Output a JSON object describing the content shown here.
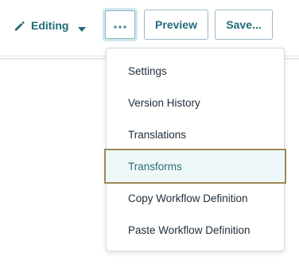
{
  "toolbar": {
    "mode_label": "Editing",
    "mode_icon": "pencil-icon",
    "mode_dropdown_icon": "caret-down-icon",
    "more_icon": "ellipsis-icon",
    "preview_label": "Preview",
    "save_label": "Save..."
  },
  "menu": {
    "items": [
      {
        "label": "Settings"
      },
      {
        "label": "Version History"
      },
      {
        "label": "Translations"
      },
      {
        "label": "Transforms",
        "highlighted": true
      },
      {
        "label": "Copy Workflow Definition"
      },
      {
        "label": "Paste Workflow Definition"
      }
    ]
  },
  "colors": {
    "accent": "#236b7a",
    "highlight_bg": "#eef8f8",
    "highlight_border": "#9c8a57",
    "focus_ring": "#cfe8ef"
  }
}
